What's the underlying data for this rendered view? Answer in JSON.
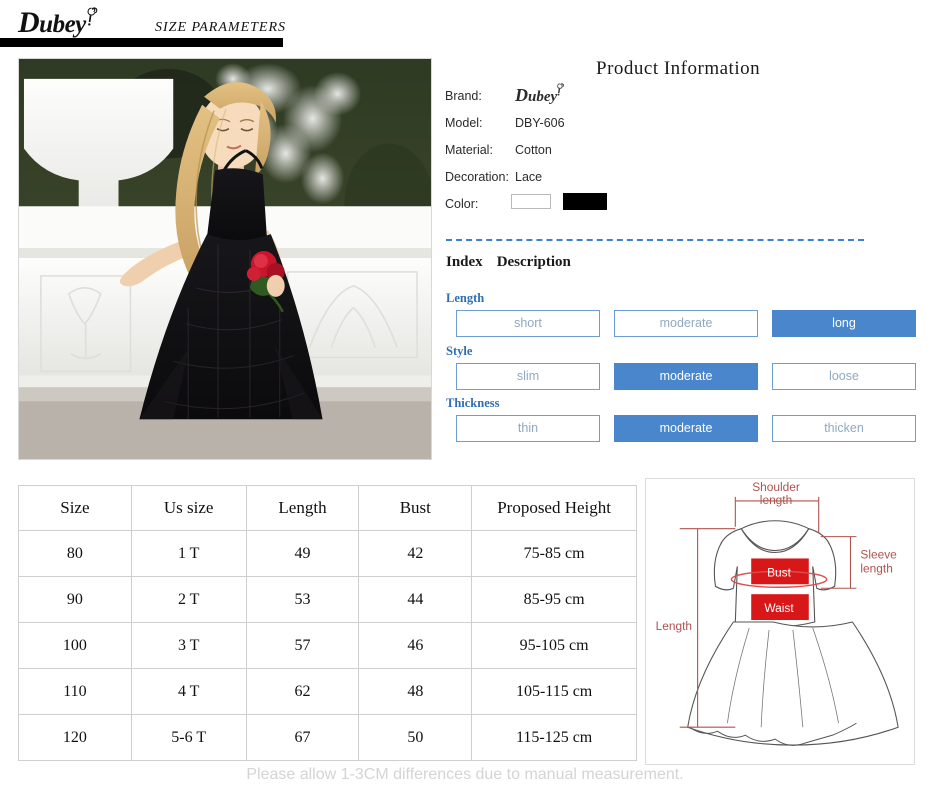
{
  "header": {
    "brand_cap": "D",
    "brand_rest": "ubey",
    "subtitle": "SIZE  PARAMETERS",
    "logo_icon": "spiral-lollipop-icon"
  },
  "photo": {
    "alt": "Girl wearing black lace halter maxi dress holding a red rose in front of a white stone balustrade",
    "dress_color": "#12100f",
    "rose_color": "#c9162a",
    "stone_color": "#f2f2f0",
    "foliage_color": "#3a4a2a"
  },
  "product_info": {
    "title": "Product  Information",
    "rows": [
      {
        "label": "Brand:",
        "value": "Dubey"
      },
      {
        "label": "Model:",
        "value": "DBY-606"
      },
      {
        "label": "Material:",
        "value": "Cotton"
      },
      {
        "label": "Decoration:",
        "value": "Lace"
      },
      {
        "label": "Color:",
        "value": ""
      }
    ],
    "color_swatches": [
      {
        "name": "white-swatch",
        "hex": "#ffffff"
      },
      {
        "name": "black-swatch",
        "hex": "#000000"
      }
    ]
  },
  "index": {
    "heading_index": "Index",
    "heading_description": "Description",
    "accent": "#4a86cb",
    "groups": [
      {
        "label": "Length",
        "options": [
          "short",
          "moderate",
          "long"
        ],
        "selected": 2
      },
      {
        "label": "Style",
        "options": [
          "slim",
          "moderate",
          "loose"
        ],
        "selected": 1
      },
      {
        "label": "Thickness",
        "options": [
          "thin",
          "moderate",
          "thicken"
        ],
        "selected": 1
      }
    ]
  },
  "size_table": {
    "headers": [
      "Size",
      "Us size",
      "Length",
      "Bust",
      "Proposed Height"
    ],
    "rows": [
      [
        "80",
        "1 T",
        "49",
        "42",
        "75-85 cm"
      ],
      [
        "90",
        "2 T",
        "53",
        "44",
        "85-95 cm"
      ],
      [
        "100",
        "3 T",
        "57",
        "46",
        "95-105 cm"
      ],
      [
        "110",
        "4 T",
        "62",
        "48",
        "105-115 cm"
      ],
      [
        "120",
        "5-6 T",
        "67",
        "50",
        "115-125 cm"
      ]
    ]
  },
  "diagram": {
    "labels": {
      "shoulder_line1": "Shoulder",
      "shoulder_line2": "length",
      "sleeve_line1": "Sleeve",
      "sleeve_line2": "length",
      "length": "Length",
      "bust": "Bust",
      "waist": "Waist"
    },
    "colors": {
      "line": "#b0534f",
      "outline": "#555555",
      "badge": "#d81818"
    }
  },
  "footer": {
    "note": "Please allow 1-3CM differences due to manual measurement."
  }
}
